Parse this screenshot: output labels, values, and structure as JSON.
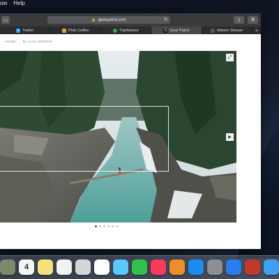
{
  "menubar": {
    "items": [
      "ow",
      "Help"
    ]
  },
  "browser": {
    "address": "gearpatrol.com",
    "tabs": [
      {
        "label": "Twitter",
        "icon": "twitter-icon",
        "color": "#1da1f2"
      },
      {
        "label": "Philz Coffee",
        "icon": "philz-icon",
        "color": "#d8a23a"
      },
      {
        "label": "TripAdvisor",
        "icon": "tripadvisor-icon",
        "color": "#34a853"
      },
      {
        "label": "Gear Patrol",
        "icon": "gearpatrol-icon",
        "color": "#111111"
      },
      {
        "label": "Meteor Shower",
        "icon": "meteor-icon",
        "color": "#555555"
      }
    ]
  },
  "page": {
    "breadcrumb": [
      "HOME",
      "By JACK SEEMER"
    ],
    "carousel": {
      "total": 6,
      "active": 0
    }
  },
  "dock": {
    "icons": [
      {
        "name": "maps-icon",
        "bg": "#7a8a6a"
      },
      {
        "name": "calendar-icon",
        "bg": "#f4f4f4",
        "glyph": "4",
        "fg": "#222"
      },
      {
        "name": "notes-icon",
        "bg": "#f7e27a"
      },
      {
        "name": "reminders-icon",
        "bg": "#f2f2f2"
      },
      {
        "name": "preview-icon",
        "bg": "#d6d6d6"
      },
      {
        "name": "photos-icon",
        "bg": "#ffffff"
      },
      {
        "name": "messages-icon",
        "bg": "#5ac8fa"
      },
      {
        "name": "facetime-icon",
        "bg": "#30c24b"
      },
      {
        "name": "music-icon",
        "bg": "#fb3b5b"
      },
      {
        "name": "books-icon",
        "bg": "#f08c2a"
      },
      {
        "name": "app-store-icon",
        "bg": "#1c8cf0"
      },
      {
        "name": "system-preferences-icon",
        "bg": "#8e8e93"
      },
      {
        "name": "keynote-icon",
        "bg": "#2b7de9"
      },
      {
        "name": "photo-booth-icon",
        "bg": "#c0392b"
      },
      {
        "name": "finder-icon",
        "bg": "#3fa0f0"
      }
    ]
  }
}
